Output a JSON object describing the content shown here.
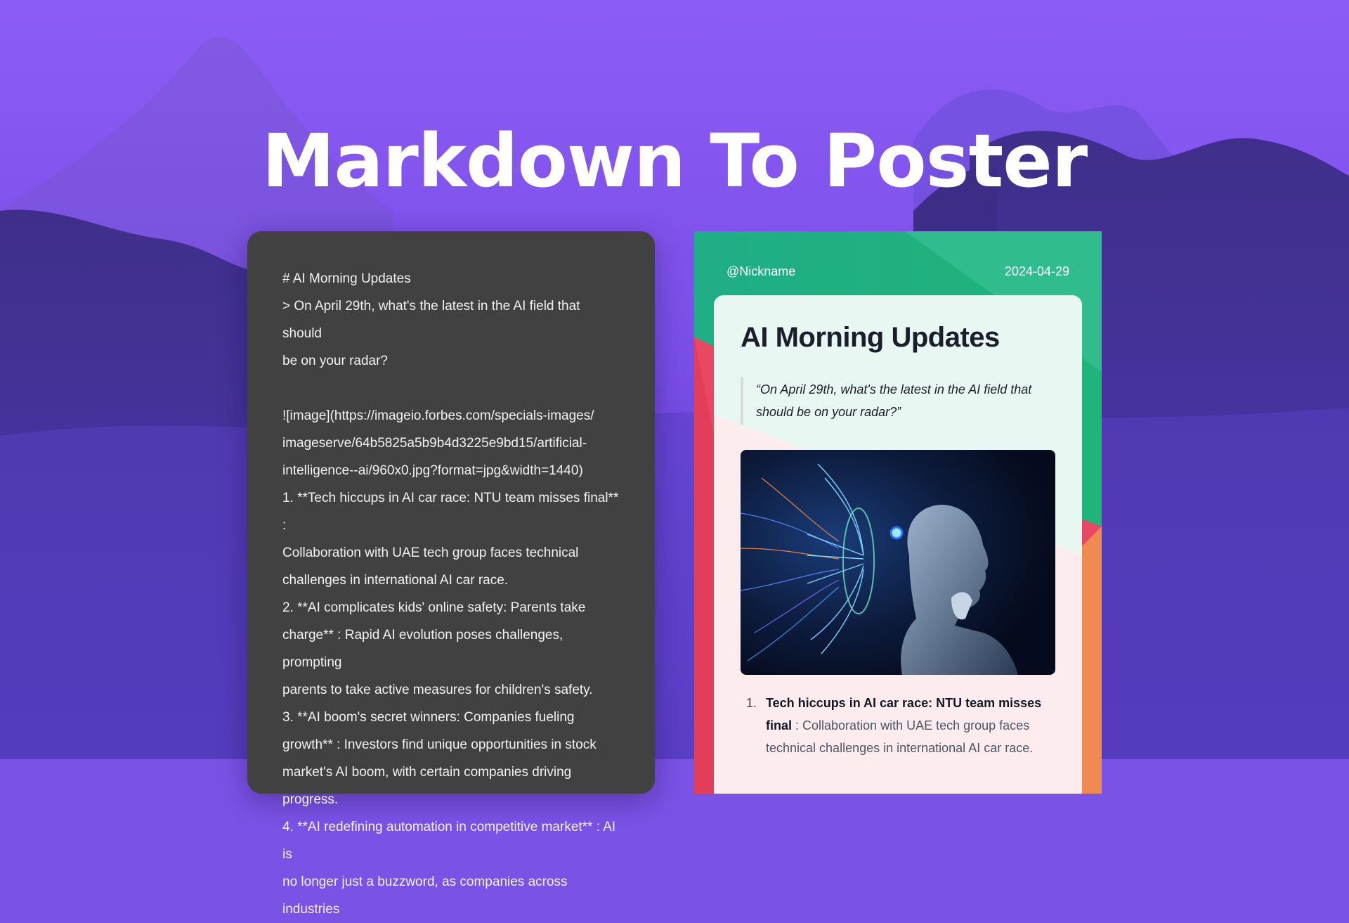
{
  "hero": {
    "title": "Markdown To Poster"
  },
  "editor": {
    "lines": [
      "# AI Morning Updates",
      "> On April 29th, what's the latest in the AI field that should",
      "be on your radar?",
      "",
      "![image](https://imageio.forbes.com/specials-images/",
      "imageserve/64b5825a5b9b4d3225e9bd15/artificial-",
      "intelligence--ai/960x0.jpg?format=jpg&width=1440)",
      "1. **Tech hiccups in AI car race: NTU team misses final** :",
      "Collaboration with UAE tech group faces technical",
      "challenges in international AI car race.",
      "2. **AI complicates kids' online safety: Parents take",
      "charge** : Rapid AI evolution poses challenges, prompting",
      "parents to take active measures for children's safety.",
      "3. **AI boom's secret winners: Companies fueling",
      "growth** : Investors find unique opportunities in stock",
      "market's AI boom, with certain companies driving progress.",
      "4. **AI redefining automation in competitive market** : AI is",
      "no longer just a buzzword, as companies across industries"
    ]
  },
  "poster": {
    "nickname": "@Nickname",
    "date": "2024-04-29",
    "title": "AI Morning Updates",
    "quote": "“On April 29th, what's the latest in the AI field that should be on your radar?”",
    "items": [
      {
        "num": "1.",
        "bold": "Tech hiccups in AI car race: NTU team misses final",
        "text": " : Collaboration with UAE tech group faces technical challenges in international AI car race."
      }
    ]
  },
  "colors": {
    "background": "#7a52e6",
    "editor_bg": "#414141",
    "poster_green": "#22b07d",
    "poster_red": "#e8455e",
    "poster_orange": "#ef8a52"
  }
}
